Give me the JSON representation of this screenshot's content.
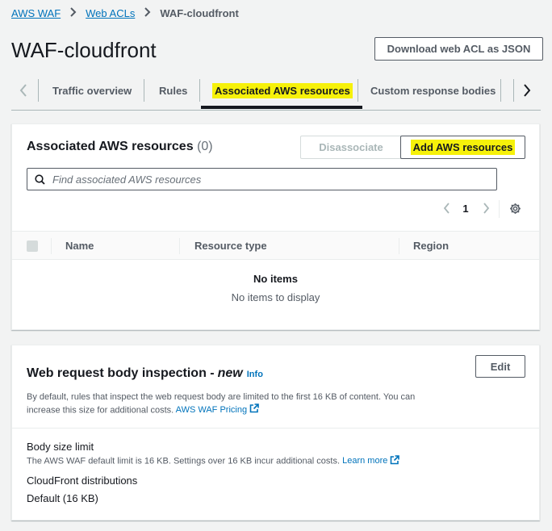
{
  "breadcrumb": {
    "items": [
      "AWS WAF",
      "Web ACLs"
    ],
    "current": "WAF-cloudfront"
  },
  "page": {
    "title": "WAF-cloudfront",
    "download_label": "Download web ACL as JSON"
  },
  "tabs": [
    "Traffic overview",
    "Rules",
    "Associated AWS resources",
    "Custom response bodies"
  ],
  "resources": {
    "heading": "Associated AWS resources",
    "count": "(0)",
    "disassociate_label": "Disassociate",
    "add_label": "Add AWS resources",
    "search_placeholder": "Find associated AWS resources",
    "page_number": "1",
    "columns": [
      "Name",
      "Resource type",
      "Region"
    ],
    "empty_title": "No items",
    "empty_subtitle": "No items to display"
  },
  "inspection": {
    "heading": "Web request body inspection -",
    "new_label": "new",
    "info_label": "Info",
    "edit_label": "Edit",
    "description": "By default, rules that inspect the web request body are limited to the first 16 KB of content. You can increase this size for additional costs.",
    "pricing_link": "AWS WAF Pricing",
    "size_limit_label": "Body size limit",
    "size_limit_desc": "The AWS WAF default limit is 16 KB. Settings over 16 KB incur additional costs.",
    "learn_more": "Learn more",
    "cf_label": "CloudFront distributions",
    "cf_value": "Default (16 KB)"
  },
  "colors": {
    "link": "#0073bb",
    "highlight": "#f6f10a",
    "text": "#16191f",
    "muted": "#545b64"
  }
}
